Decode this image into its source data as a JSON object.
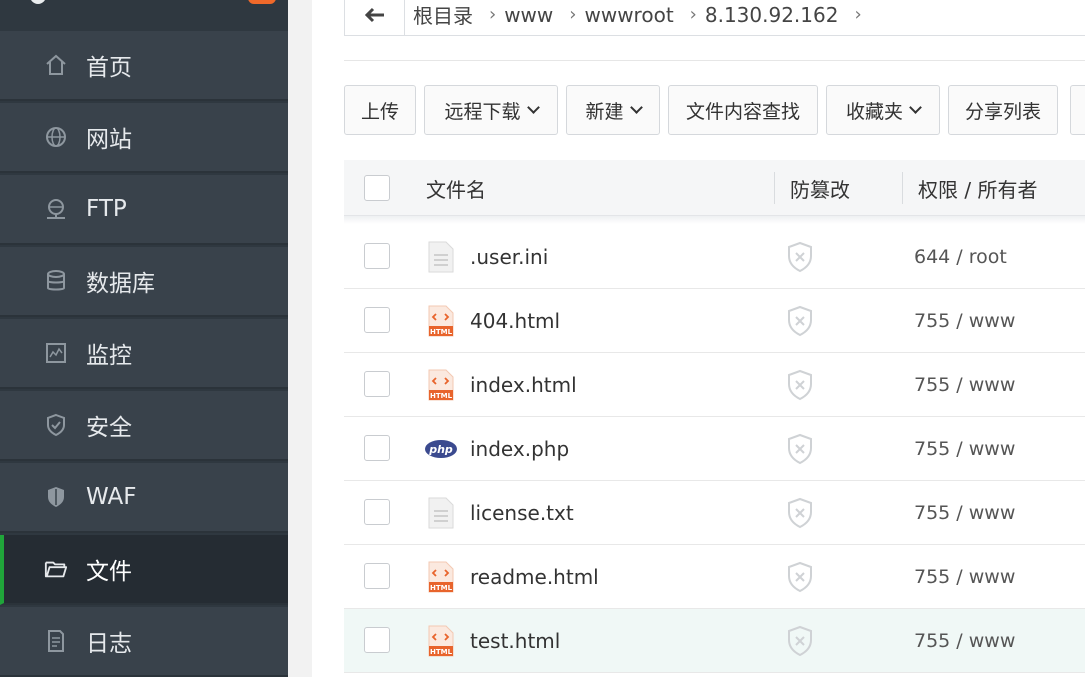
{
  "sidebar": {
    "items": [
      {
        "label": "首页",
        "icon": "home-icon"
      },
      {
        "label": "网站",
        "icon": "globe-icon"
      },
      {
        "label": "FTP",
        "icon": "ftp-icon"
      },
      {
        "label": "数据库",
        "icon": "database-icon"
      },
      {
        "label": "监控",
        "icon": "monitor-icon"
      },
      {
        "label": "安全",
        "icon": "shield-check-icon"
      },
      {
        "label": "WAF",
        "icon": "waf-shield-icon"
      },
      {
        "label": "文件",
        "icon": "folder-icon",
        "active": true
      },
      {
        "label": "日志",
        "icon": "log-icon"
      }
    ],
    "active_color": "#20a53a"
  },
  "breadcrumb": {
    "items": [
      "根目录",
      "www",
      "wwwroot",
      "8.130.92.162"
    ]
  },
  "toolbar": {
    "upload": "上传",
    "remote_download": "远程下载",
    "new": "新建",
    "content_search": "文件内容查找",
    "favorites": "收藏夹",
    "share_list": "分享列表"
  },
  "table": {
    "headers": {
      "name": "文件名",
      "tamper": "防篡改",
      "perm": "权限 / 所有者"
    },
    "rows": [
      {
        "name": ".user.ini",
        "type": "text",
        "perm": "644 / root"
      },
      {
        "name": "404.html",
        "type": "html",
        "perm": "755 / www"
      },
      {
        "name": "index.html",
        "type": "html",
        "perm": "755 / www"
      },
      {
        "name": "index.php",
        "type": "php",
        "perm": "755 / www"
      },
      {
        "name": "license.txt",
        "type": "text",
        "perm": "755 / www"
      },
      {
        "name": "readme.html",
        "type": "html",
        "perm": "755 / www"
      },
      {
        "name": "test.html",
        "type": "html",
        "perm": "755 / www",
        "highlighted": true
      }
    ]
  },
  "colors": {
    "html_icon": "#e8642c",
    "php_icon": "#3b4a8f"
  }
}
